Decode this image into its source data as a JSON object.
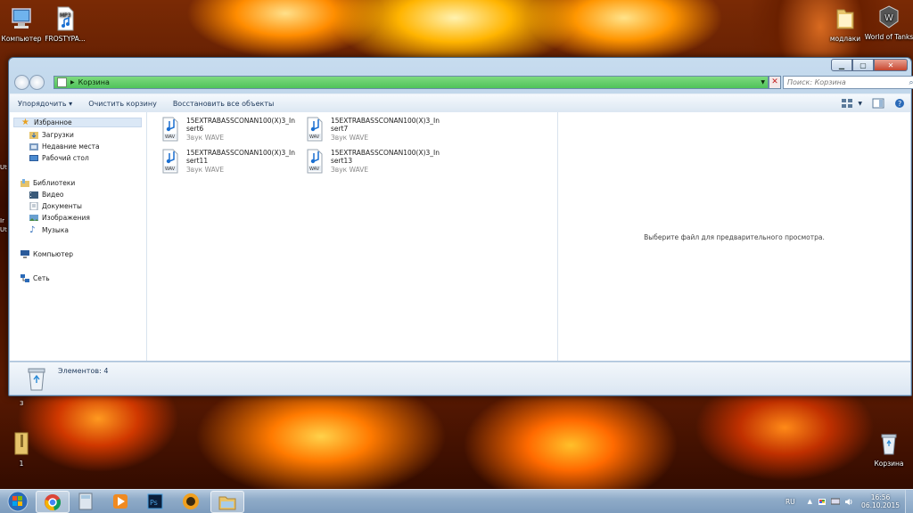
{
  "desktop": {
    "icons": [
      {
        "label": "Компьютер"
      },
      {
        "label": "FROSTYPA..."
      },
      {
        "label": "модлаки"
      },
      {
        "label": "World of Tanks"
      },
      {
        "label": "1"
      },
      {
        "label": "Корзина"
      }
    ],
    "edge_texts": [
      "3",
      "Ut",
      "Ir",
      "Ut"
    ]
  },
  "window": {
    "address": {
      "path": "Корзина"
    },
    "search_placeholder": "Поиск: Корзина",
    "toolbar": {
      "organize": "Упорядочить ▾",
      "empty_bin": "Очистить корзину",
      "restore_all": "Восстановить все объекты"
    },
    "nav": {
      "favorites": "Избранное",
      "downloads": "Загрузки",
      "recent": "Недавние места",
      "desktop": "Рабочий стол",
      "libraries": "Библиотеки",
      "video": "Видео",
      "documents": "Документы",
      "images": "Изображения",
      "music": "Музыка",
      "computer": "Компьютер",
      "network": "Сеть"
    },
    "files": [
      {
        "name": "15EXTRABASSCONAN100(X)3_Insert6",
        "type": "Звук WAVE"
      },
      {
        "name": "15EXTRABASSCONAN100(X)3_Insert7",
        "type": "Звук WAVE"
      },
      {
        "name": "15EXTRABASSCONAN100(X)3_Insert11",
        "type": "Звук WAVE"
      },
      {
        "name": "15EXTRABASSCONAN100(X)3_Insert13",
        "type": "Звук WAVE"
      }
    ],
    "preview_message": "Выберите файл для предварительного просмотра.",
    "status": {
      "items_count": "Элементов: 4"
    }
  },
  "taskbar": {
    "language": "RU",
    "time": "16:56",
    "date": "06.10.2015",
    "apps": [
      "start-icon",
      "chrome-icon",
      "calculator-icon",
      "media-player-icon",
      "photoshop-icon",
      "fl-studio-icon",
      "explorer-icon"
    ]
  },
  "colors": {
    "address_bar": "#5fcd67",
    "taskbar": "#8fabc8",
    "window_frame": "#b6cde3"
  }
}
